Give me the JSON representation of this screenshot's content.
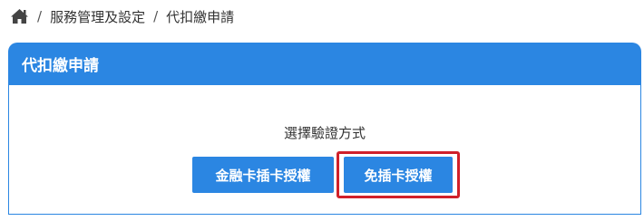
{
  "breadcrumb": {
    "home_icon": "home-icon",
    "separator": "/",
    "items": [
      "服務管理及設定",
      "代扣繳申請"
    ]
  },
  "panel": {
    "title": "代扣繳申請",
    "prompt": "選擇驗證方式",
    "buttons": {
      "card_auth": "金融卡插卡授權",
      "no_card_auth": "免插卡授權"
    }
  },
  "colors": {
    "accent": "#2b86e2",
    "highlight_border": "#d0202a"
  }
}
